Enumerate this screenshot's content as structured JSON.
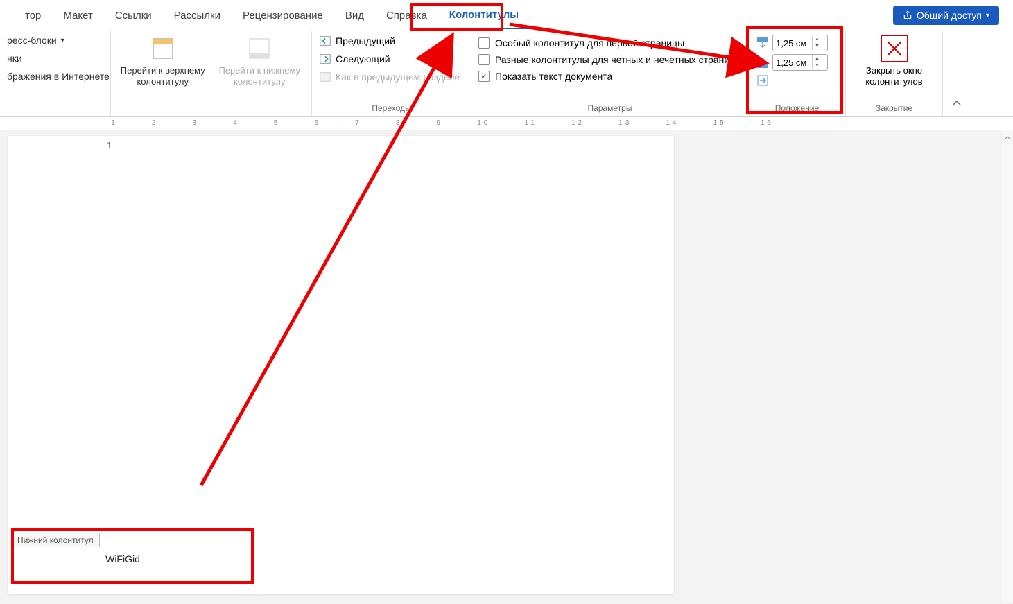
{
  "tabs": {
    "items": [
      "тор",
      "Макет",
      "Ссылки",
      "Рассылки",
      "Рецензирование",
      "Вид",
      "Справка",
      "Колонтитулы"
    ],
    "activeIndex": 7
  },
  "share": {
    "label": "Общий доступ"
  },
  "ribbon": {
    "inserts": {
      "express": "ресс-блоки",
      "pics": "нки",
      "web": "бражения в Интернете"
    },
    "nav": {
      "top": "Перейти к верхнему колонтитулу",
      "bottom": "Перейти к нижнему колонтитулу"
    },
    "transitions": {
      "prev": "Предыдущий",
      "next": "Следующий",
      "same": "Как в предыдущем разделе",
      "group": "Переходы"
    },
    "params": {
      "diff_first": "Особый колонтитул для первой страницы",
      "diff_odd": "Разные колонтитулы для четных и нечетных страниц",
      "show_text": "Показать текст документа",
      "group": "Параметры"
    },
    "position": {
      "top_val": "1,25 см",
      "bottom_val": "1,25 см",
      "group": "Положение"
    },
    "close": {
      "label": "Закрыть окно колонтитулов",
      "group": "Закрытие"
    }
  },
  "ruler": {
    "marks": "· · 1 · · · 2 · · · 3 · · · 4 · · · 5 · · · 6 · · · 7 · · · 8 · · · 9 · · · 10 · · · 11 · · · 12 · · · 13 · · · 14 · · · 15 · · · 16 · · ·"
  },
  "page": {
    "number": "1",
    "footer_tag": "Нижний колонтитул",
    "footer_text": "WiFiGid"
  }
}
